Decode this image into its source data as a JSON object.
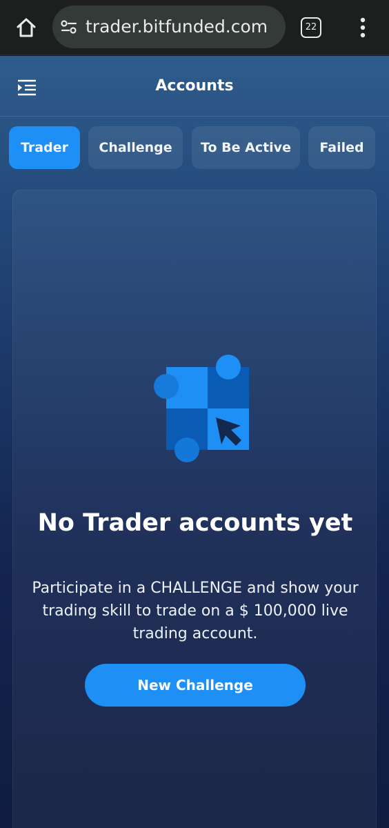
{
  "browser": {
    "url": "trader.bitfunded.com",
    "tab_count": "22",
    "icons": [
      "home-icon",
      "site-settings-icon",
      "tab-switcher-icon",
      "more-vert-icon"
    ]
  },
  "header": {
    "title": "Accounts",
    "menu_icon": "menu-expand-icon"
  },
  "tabs": [
    {
      "label": "Trader",
      "active": true
    },
    {
      "label": "Challenge",
      "active": false
    },
    {
      "label": "To Be Active",
      "active": false
    },
    {
      "label": "Failed",
      "active": false
    }
  ],
  "empty_state": {
    "illustration_icon": "checkerboard-cursor-icon",
    "title": "No Trader accounts yet",
    "description": "Participate in a CHALLENGE and show your trading skill to trade on a $ 100,000 live trading account.",
    "button_label": "New Challenge"
  },
  "colors": {
    "accent": "#1e8ff5",
    "accent_dark": "#0a5bb3",
    "browser_bar": "#1c1f1d",
    "url_pill": "#343a37"
  }
}
